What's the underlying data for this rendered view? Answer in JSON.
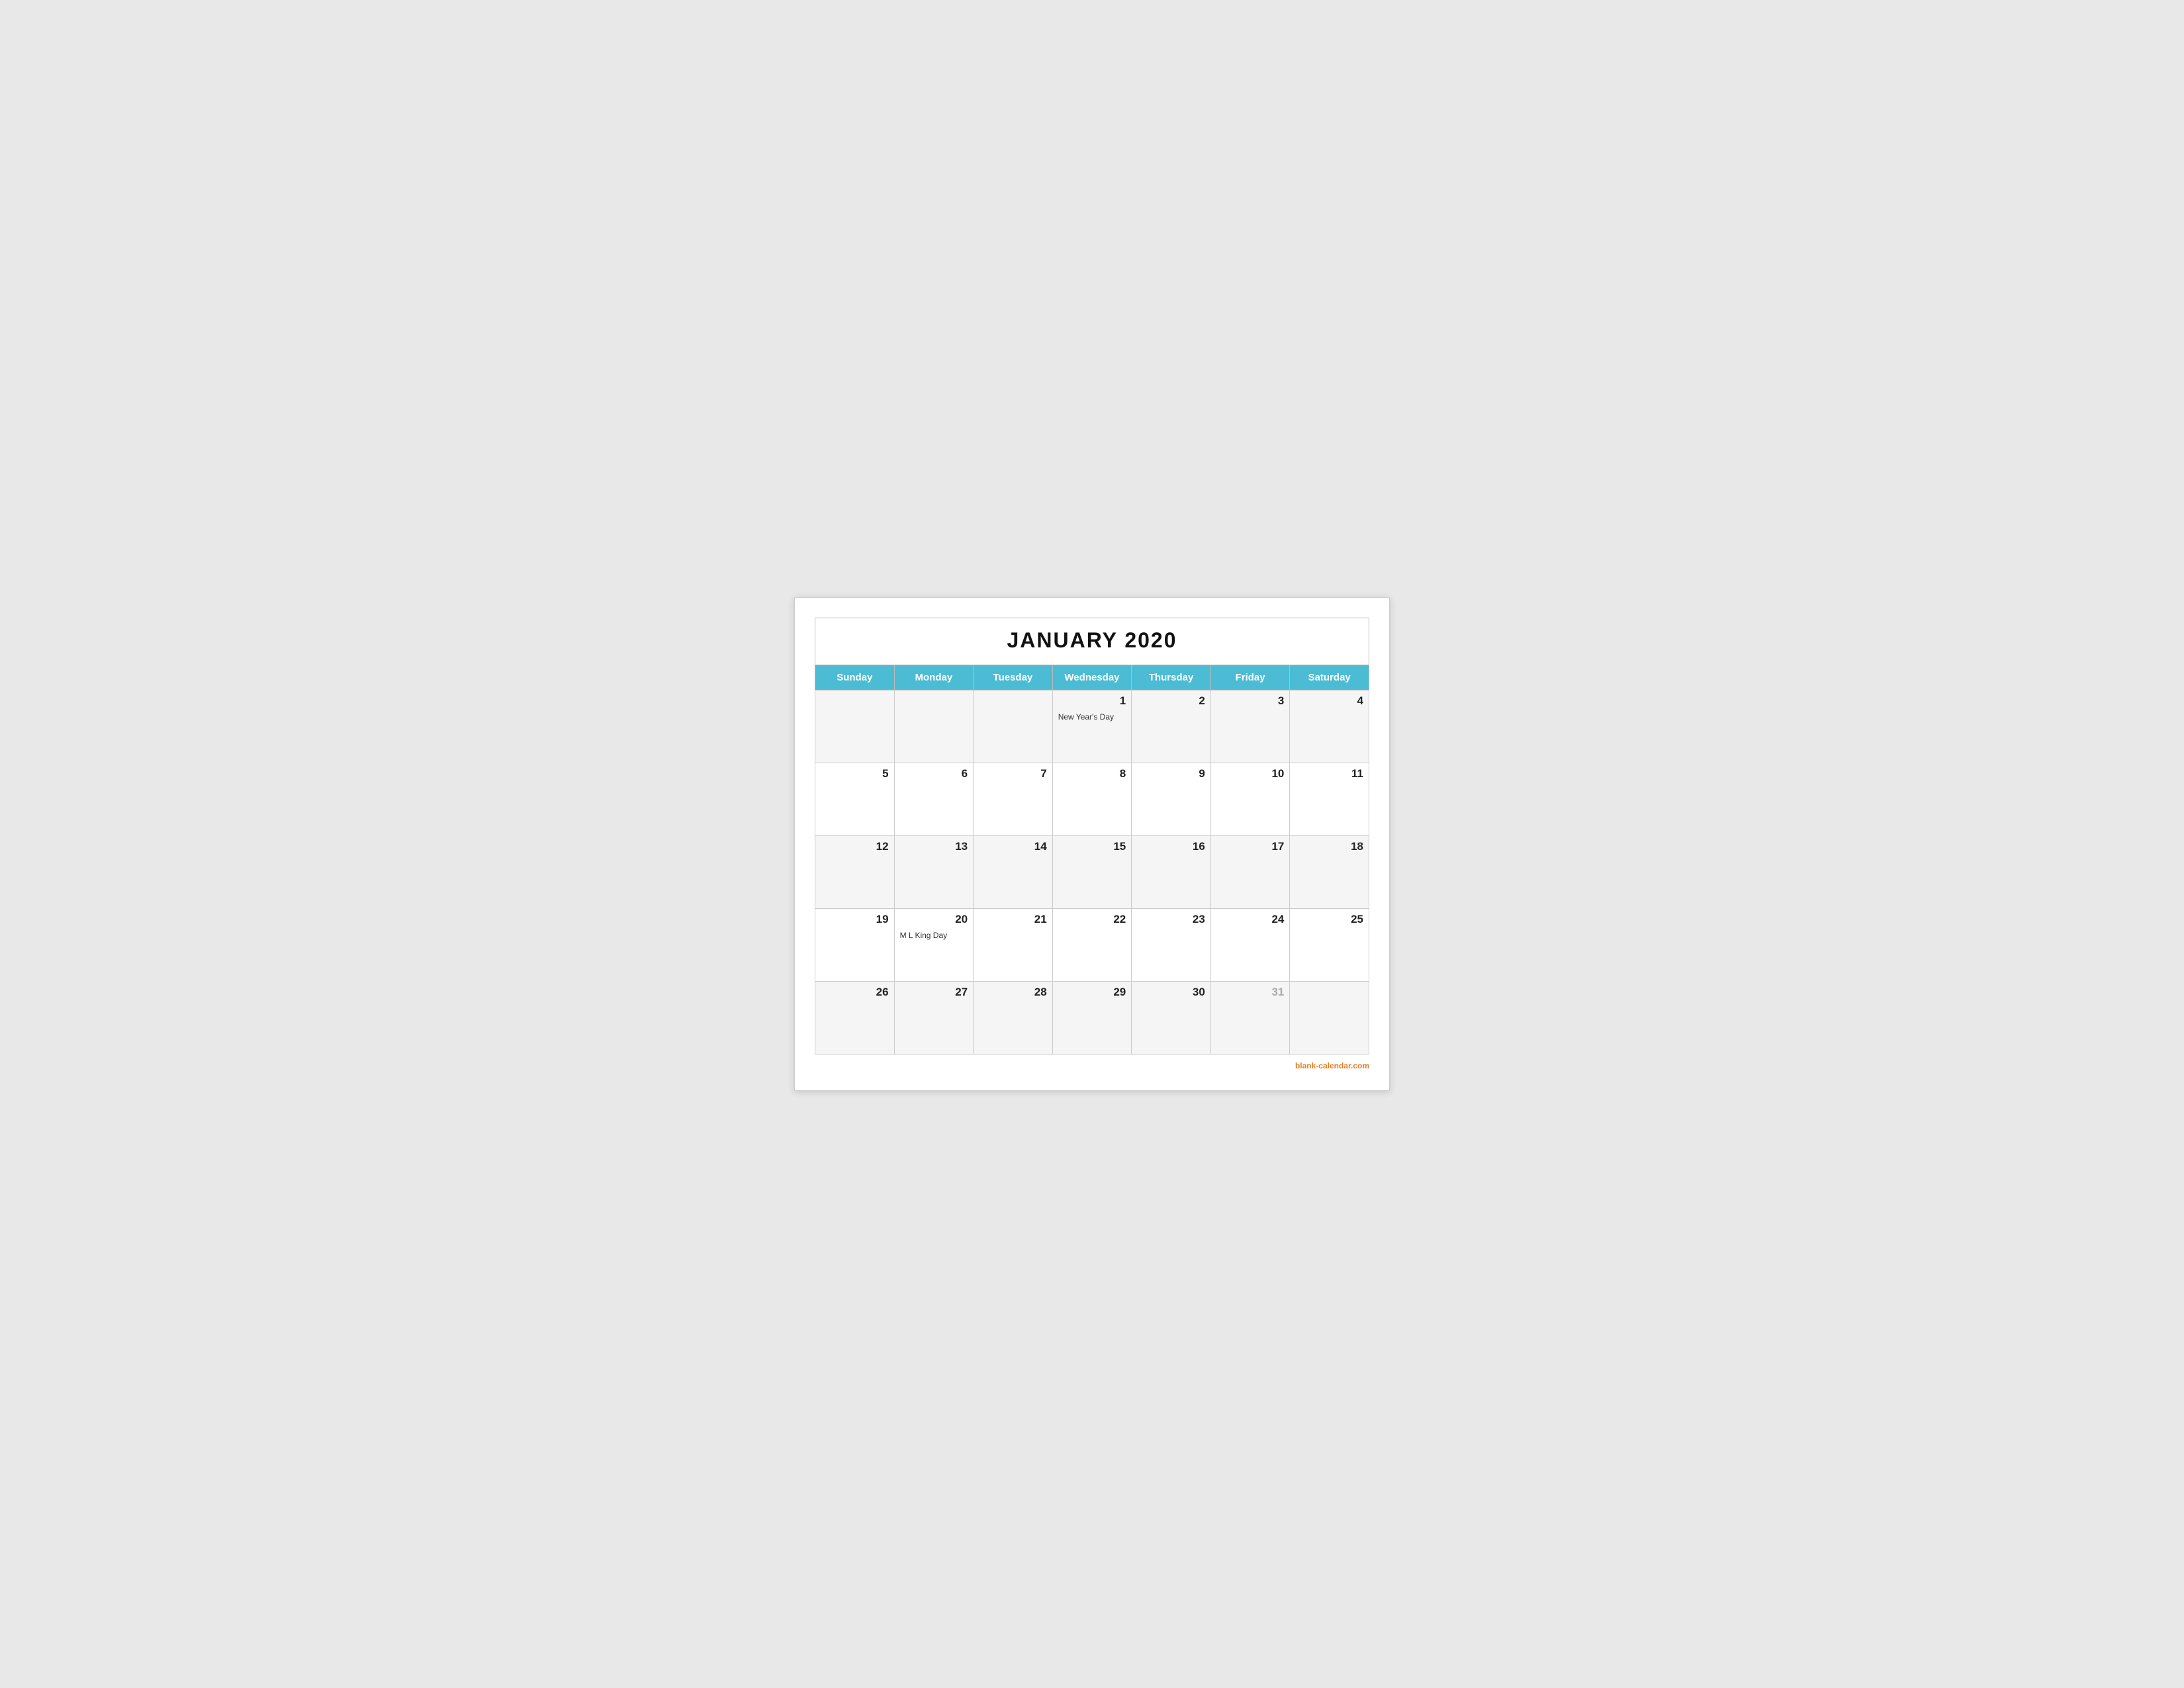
{
  "calendar": {
    "title": "JANUARY 2020",
    "headers": [
      "Sunday",
      "Monday",
      "Tuesday",
      "Wednesday",
      "Thursday",
      "Friday",
      "Saturday"
    ],
    "weeks": [
      [
        {
          "date": "",
          "holiday": ""
        },
        {
          "date": "",
          "holiday": ""
        },
        {
          "date": "",
          "holiday": ""
        },
        {
          "date": "1",
          "holiday": "New Year's Day"
        },
        {
          "date": "2",
          "holiday": ""
        },
        {
          "date": "3",
          "holiday": ""
        },
        {
          "date": "4",
          "holiday": ""
        }
      ],
      [
        {
          "date": "5",
          "holiday": ""
        },
        {
          "date": "6",
          "holiday": ""
        },
        {
          "date": "7",
          "holiday": ""
        },
        {
          "date": "8",
          "holiday": ""
        },
        {
          "date": "9",
          "holiday": ""
        },
        {
          "date": "10",
          "holiday": ""
        },
        {
          "date": "11",
          "holiday": ""
        }
      ],
      [
        {
          "date": "12",
          "holiday": ""
        },
        {
          "date": "13",
          "holiday": ""
        },
        {
          "date": "14",
          "holiday": ""
        },
        {
          "date": "15",
          "holiday": ""
        },
        {
          "date": "16",
          "holiday": ""
        },
        {
          "date": "17",
          "holiday": ""
        },
        {
          "date": "18",
          "holiday": ""
        }
      ],
      [
        {
          "date": "19",
          "holiday": ""
        },
        {
          "date": "20",
          "holiday": "M L King Day"
        },
        {
          "date": "21",
          "holiday": ""
        },
        {
          "date": "22",
          "holiday": ""
        },
        {
          "date": "23",
          "holiday": ""
        },
        {
          "date": "24",
          "holiday": ""
        },
        {
          "date": "25",
          "holiday": ""
        }
      ],
      [
        {
          "date": "26",
          "holiday": ""
        },
        {
          "date": "27",
          "holiday": ""
        },
        {
          "date": "28",
          "holiday": ""
        },
        {
          "date": "29",
          "holiday": ""
        },
        {
          "date": "30",
          "holiday": ""
        },
        {
          "date": "31",
          "muted": true,
          "holiday": ""
        },
        {
          "date": "",
          "holiday": ""
        }
      ]
    ],
    "footer": {
      "text": "blank-calendar.com",
      "color": "#e67e22"
    }
  }
}
